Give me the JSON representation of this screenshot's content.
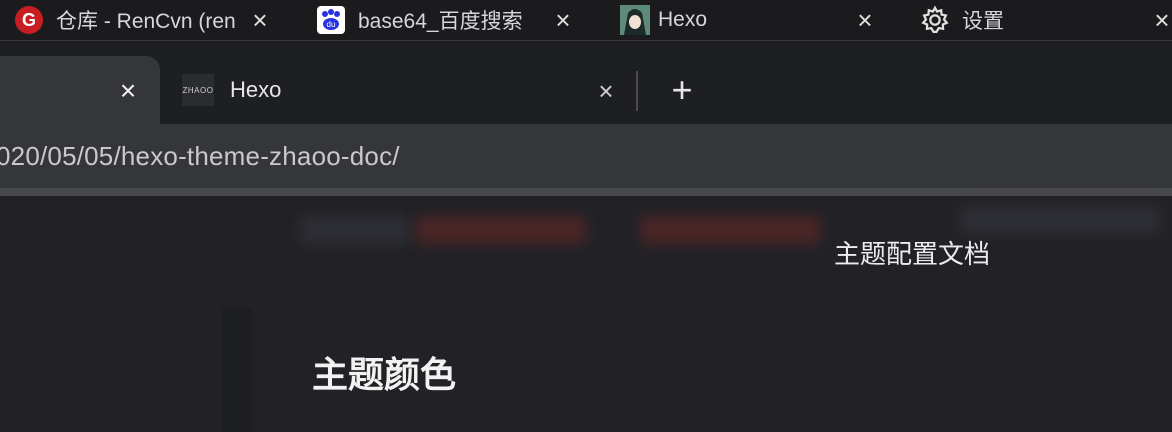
{
  "os_tabs": [
    {
      "label": "仓库 - RenCvn (ren",
      "icon": "gitee-icon"
    },
    {
      "label": "base64_百度搜索",
      "icon": "baidu-icon"
    },
    {
      "label": "Hexo",
      "icon": "anime-avatar-icon"
    },
    {
      "label": "设置",
      "icon": "gear-icon"
    }
  ],
  "browser": {
    "active_tab_close": "×",
    "tab2": {
      "title": "Hexo",
      "favicon_text": "ZHAOO",
      "close": "×"
    },
    "new_tab": "+",
    "url": "020/05/05/hexo-theme-zhaoo-doc/"
  },
  "page": {
    "heading": "主题配置文档",
    "section_title": "主题颜色"
  },
  "colors": {
    "gitee_red": "#c71d23",
    "baidu_blue": "#2932e1",
    "page_bg": "#222226"
  }
}
